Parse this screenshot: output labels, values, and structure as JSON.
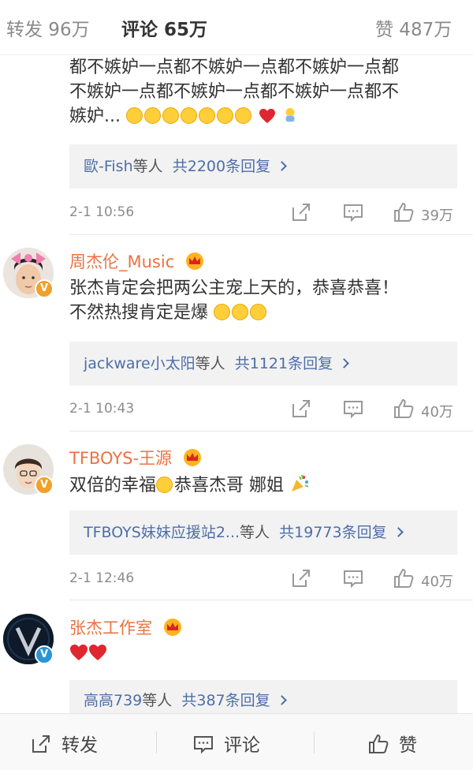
{
  "tabs": {
    "repost": "转发 96万",
    "comment": "评论 65万",
    "like": "赞 487万"
  },
  "comments": [
    {
      "text_line1": "都不嫉妒一点都不嫉妒一点都不嫉妒一点都",
      "text_line2": "不嫉妒一点都不嫉妒一点都不嫉妒一点都不",
      "text_line3": "嫉妒...",
      "reply_user": "歐-Fish",
      "reply_suffix": "等人",
      "reply_count": "共2200条回复",
      "time": "2-1 10:56",
      "likes": "39万"
    },
    {
      "username": "周杰伦_Music",
      "text_line1": "张杰肯定会把两公主宠上天的，恭喜恭喜！",
      "text_line2": "不然热搜肯定是爆",
      "reply_user": "jackware小太阳",
      "reply_suffix": "等人",
      "reply_count": "共1121条回复",
      "time": "2-1 10:43",
      "likes": "40万",
      "badge": "V"
    },
    {
      "username": "TFBOYS-王源",
      "text_a": "双倍的幸福",
      "text_b": "恭喜杰哥 娜姐",
      "reply_user": "TFBOYS妹妹应援站2...",
      "reply_suffix": "等人",
      "reply_count": "共19773条回复",
      "time": "2-1 12:46",
      "likes": "40万",
      "badge": "V"
    },
    {
      "username": "张杰工作室",
      "reply_user": "高高739",
      "reply_suffix": "等人",
      "reply_count": "共387条回复",
      "badge": "V"
    }
  ],
  "bottombar": {
    "repost": "转发",
    "comment": "评论",
    "like": "赞"
  },
  "colors": {
    "accent": "#ff8200",
    "username": "#eb7340",
    "link": "#4e6ea8",
    "heart": "#e0262f"
  }
}
